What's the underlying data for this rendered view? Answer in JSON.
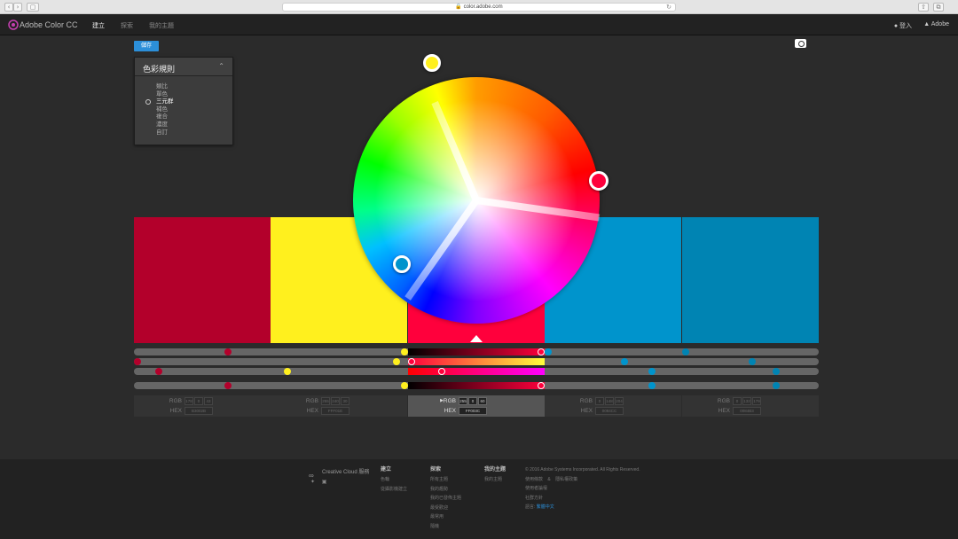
{
  "browser": {
    "url": "color.adobe.com"
  },
  "nav": {
    "brand": "Adobe Color CC",
    "tabs": [
      "建立",
      "探索",
      "我的主題"
    ],
    "login": "登入",
    "adobe": "Adobe"
  },
  "toolbar": {
    "save_label": "儲存"
  },
  "rules_panel": {
    "title": "色彩規則",
    "items": [
      "類比",
      "單色",
      "三元群",
      "補色",
      "複合",
      "濃度",
      "自訂"
    ],
    "selected_index": 2
  },
  "swatches": [
    {
      "color": "#B3002B",
      "rgb": [
        "178",
        "0",
        "43"
      ],
      "hex": "B3002B"
    },
    {
      "color": "#FFF01E",
      "rgb": [
        "255",
        "240",
        "30"
      ],
      "hex": "FFF01E"
    },
    {
      "color": "#FF003C",
      "rgb": [
        "255",
        "0",
        "60"
      ],
      "hex": "FF003C"
    },
    {
      "color": "#0094CC",
      "rgb": [
        "0",
        "148",
        "204"
      ],
      "hex": "0094CC"
    },
    {
      "color": "#0084B3",
      "rgb": [
        "0",
        "132",
        "179"
      ],
      "hex": "0084B3"
    }
  ],
  "selected_swatch": 2,
  "value_labels": {
    "rgb": "RGB",
    "hex": "HEX"
  },
  "footer": {
    "cc_label": "Creative Cloud 服務",
    "columns": [
      {
        "heading": "建立",
        "items": [
          "色輪",
          "從攝影機建立"
        ]
      },
      {
        "heading": "探索",
        "items": [
          "所有主題",
          "我的趨勢",
          "我的已發佈主題",
          "最受歡迎",
          "最常用",
          "隨機"
        ]
      },
      {
        "heading": "我的主題",
        "items": [
          "我的主題"
        ]
      }
    ],
    "copyright": "© 2016 Adobe Systems Incorporated. All Rights Reserved.",
    "links": [
      "使用條款",
      "隱私權政策",
      "使用者論壇",
      "社群方針"
    ],
    "language_label": "語言:",
    "language_value": "繁體中文"
  }
}
